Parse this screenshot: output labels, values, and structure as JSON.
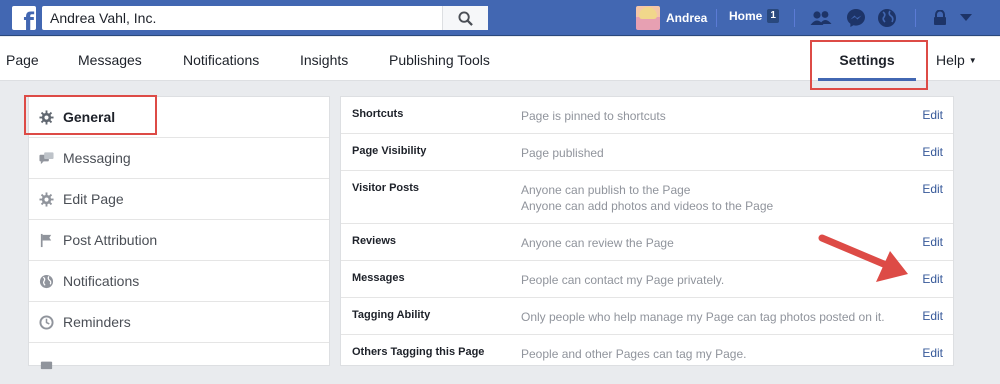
{
  "topbar": {
    "logo_icon": "facebook-f-icon",
    "search_value": "Andrea Vahl, Inc.",
    "user_name": "Andrea",
    "home_label": "Home",
    "home_count": "1",
    "brand_color": "#4267b2"
  },
  "pagenav": {
    "items": [
      "Page",
      "Messages",
      "Notifications",
      "Insights",
      "Publishing Tools"
    ],
    "settings_label": "Settings",
    "help_label": "Help"
  },
  "leftmenu": {
    "items": [
      {
        "label": "General",
        "icon": "gear-icon"
      },
      {
        "label": "Messaging",
        "icon": "chat-bubbles-icon"
      },
      {
        "label": "Edit Page",
        "icon": "gear-icon"
      },
      {
        "label": "Post Attribution",
        "icon": "flag-icon"
      },
      {
        "label": "Notifications",
        "icon": "globe-icon"
      },
      {
        "label": "Reminders",
        "icon": "clock-icon"
      }
    ]
  },
  "settings": {
    "edit_label": "Edit",
    "rows": [
      {
        "name": "Shortcuts",
        "value": "Page is pinned to shortcuts",
        "value2": ""
      },
      {
        "name": "Page Visibility",
        "value": "Page published",
        "value2": ""
      },
      {
        "name": "Visitor Posts",
        "value": "Anyone can publish to the Page",
        "value2": "Anyone can add photos and videos to the Page"
      },
      {
        "name": "Reviews",
        "value": "Anyone can review the Page",
        "value2": ""
      },
      {
        "name": "Messages",
        "value": "People can contact my Page privately.",
        "value2": ""
      },
      {
        "name": "Tagging Ability",
        "value": "Only people who help manage my Page can tag photos posted on it.",
        "value2": ""
      },
      {
        "name": "Others Tagging this Page",
        "value": "People and other Pages can tag my Page.",
        "value2": ""
      }
    ]
  },
  "annotation_color": "#dd4b46"
}
